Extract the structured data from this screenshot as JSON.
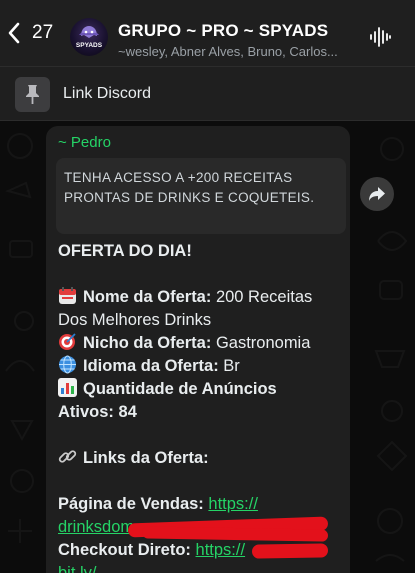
{
  "header": {
    "back_count": "27",
    "title": "GRUPO ~ PRO ~ SPYADS",
    "members": "~wesley, Abner Alves, Bruno, Carlos...",
    "avatar_text": "SPYADS"
  },
  "pinned": {
    "text": "Link Discord"
  },
  "message": {
    "sender": "~ Pedro",
    "quote": "TENHA ACESSO A +200 RECEITAS PRONTAS DE DRINKS E COQUETEIS.",
    "headline": "OFERTA DO DIA!",
    "nome_label": "Nome da Oferta:",
    "nome_value": " 200 Receitas",
    "nome_value_cont": "Dos Melhores Drinks",
    "nicho_label": "Nicho da Oferta:",
    "nicho_value": " Gastronomia",
    "idioma_label": "Idioma da Oferta:",
    "idioma_value": " Br",
    "quantidade_label": "Quantidade de Anúncios",
    "ativos_label": "Ativos:",
    "ativos_value": "84",
    "links_label": "Links da Oferta:",
    "vendas_label": "Página de Vendas:",
    "vendas_link": "https://",
    "vendas_link_cont": "drinksdom",
    "checkout_label": "Checkout Direto:",
    "checkout_link": "https://",
    "checkout_link_cont": "bit.ly/"
  },
  "colors": {
    "accent_green": "#25d366",
    "header_bg": "#1f1f1f",
    "bubble_bg": "#1f1f1f",
    "redaction": "#e3111b"
  },
  "icons": {
    "back": "chevron-left-icon",
    "audio": "waveform-icon",
    "pin": "pin-icon",
    "forward": "forward-arrow-icon"
  }
}
